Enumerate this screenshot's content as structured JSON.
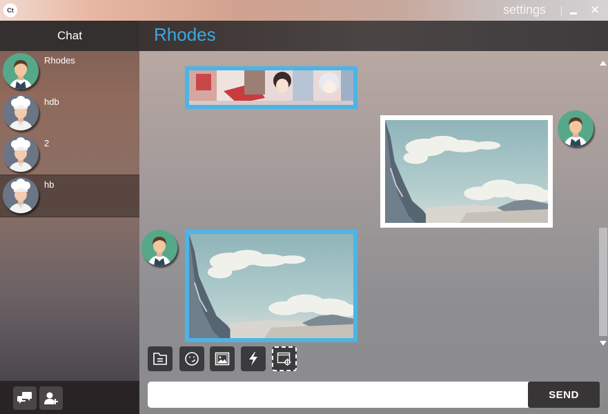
{
  "titlebar": {
    "app_icon_text": "Ct",
    "settings_label": "settings",
    "minimize_icon": "minimize-icon",
    "close_icon": "close-icon",
    "close_glyph": "✕"
  },
  "sidebar": {
    "header": "Chat",
    "contacts": [
      {
        "name": "Rhodes",
        "avatar": "male-user-avatar"
      },
      {
        "name": "hdb",
        "avatar": "chef-avatar"
      },
      {
        "name": "2",
        "avatar": "chef-avatar"
      },
      {
        "name": "hb",
        "avatar": "chef-avatar",
        "selected": true
      }
    ],
    "bottom_buttons": [
      "chat-bubbles-icon",
      "add-user-icon"
    ]
  },
  "chat": {
    "title": "Rhodes",
    "messages": [
      {
        "direction": "received",
        "type": "image",
        "content": "anime-collage-image"
      },
      {
        "direction": "sent",
        "type": "image",
        "content": "mountain-clouds-image"
      },
      {
        "direction": "received",
        "type": "image",
        "content": "mountain-clouds-image"
      }
    ]
  },
  "toolbar": {
    "tools": [
      "file-icon",
      "emoji-icon",
      "image-icon",
      "lightning-icon",
      "screenshot-icon"
    ]
  },
  "composer": {
    "input_value": "",
    "input_placeholder": "",
    "send_label": "SEND"
  },
  "colors": {
    "accent": "#3da7e0",
    "received_border": "#4db4e5",
    "sent_border": "#ffffff",
    "header_dark": "#33302f"
  }
}
